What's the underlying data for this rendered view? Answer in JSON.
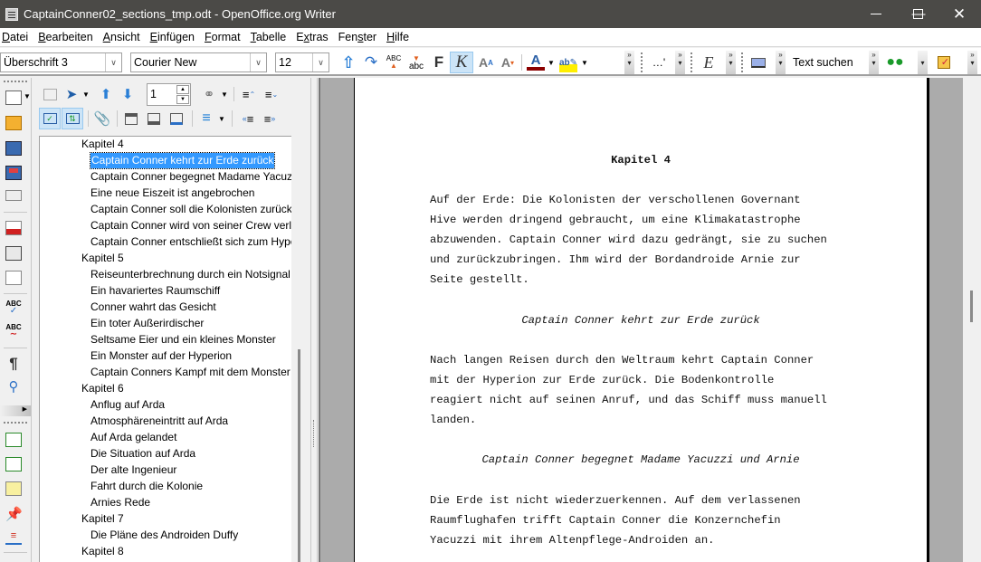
{
  "window": {
    "title": "CaptainConner02_sections_tmp.odt - OpenOffice.org Writer",
    "minimize_icon": "minimize-icon",
    "maximize_icon": "maximize-icon",
    "close_icon": "close-icon"
  },
  "menu": {
    "items": [
      {
        "label": "Datei",
        "accel": "D"
      },
      {
        "label": "Bearbeiten",
        "accel": "B"
      },
      {
        "label": "Ansicht",
        "accel": "A"
      },
      {
        "label": "Einfügen",
        "accel": "E"
      },
      {
        "label": "Format",
        "accel": "F"
      },
      {
        "label": "Tabelle",
        "accel": "T"
      },
      {
        "label": "Extras",
        "accel": "x"
      },
      {
        "label": "Fenster",
        "accel": "s"
      },
      {
        "label": "Hilfe",
        "accel": "H"
      }
    ]
  },
  "format_toolbar": {
    "paragraph_style": "Überschrift 3",
    "font_name": "Courier New",
    "font_size": "12",
    "bold_label": "F",
    "italic_label": "K",
    "find_placeholder": "Text suchen",
    "emphasis_label": "E",
    "ellipsis_label": "…'",
    "italic_active": true
  },
  "navigator": {
    "page_number": "1",
    "tree": [
      {
        "label": "Kapitel 4",
        "level": 0
      },
      {
        "label": "Captain Conner kehrt zur Erde zurück",
        "level": 1,
        "selected": true
      },
      {
        "label": "Captain Conner begegnet Madame Yacuzzi und Arnie",
        "level": 1
      },
      {
        "label": "Eine neue Eiszeit ist angebrochen",
        "level": 1
      },
      {
        "label": "Captain Conner soll die Kolonisten zurückholen",
        "level": 1
      },
      {
        "label": "Captain Conner wird von seiner Crew verlassen",
        "level": 1
      },
      {
        "label": "Captain Conner entschließt sich zum Hyperion",
        "level": 1
      },
      {
        "label": "Kapitel 5",
        "level": 0
      },
      {
        "label": "Reiseunterbrechnung durch ein Notsignal",
        "level": 1
      },
      {
        "label": "Ein havariertes Raumschiff",
        "level": 1
      },
      {
        "label": "Conner wahrt das Gesicht",
        "level": 1
      },
      {
        "label": "Ein toter Außerirdischer",
        "level": 1
      },
      {
        "label": "Seltsame Eier und ein kleines Monster",
        "level": 1
      },
      {
        "label": "Ein Monster auf der Hyperion",
        "level": 1
      },
      {
        "label": "Captain Conners Kampf mit dem Monster",
        "level": 1
      },
      {
        "label": "Kapitel 6",
        "level": 0
      },
      {
        "label": "Anflug auf Arda",
        "level": 1
      },
      {
        "label": "Atmosphäreneintritt auf Arda",
        "level": 1
      },
      {
        "label": "Auf Arda gelandet",
        "level": 1
      },
      {
        "label": "Die Situation auf Arda",
        "level": 1
      },
      {
        "label": "Der alte Ingenieur",
        "level": 1
      },
      {
        "label": "Fahrt durch die Kolonie",
        "level": 1
      },
      {
        "label": "Arnies Rede",
        "level": 1
      },
      {
        "label": "Kapitel 7",
        "level": 0
      },
      {
        "label": "Die Pläne des Androiden Duffy",
        "level": 1
      },
      {
        "label": "Kapitel 8",
        "level": 0
      }
    ]
  },
  "document": {
    "heading": "Kapitel 4",
    "blocks": [
      {
        "type": "para",
        "lines": [
          "Auf der Erde: Die Kolonisten der verschollenen Governant",
          "Hive werden dringend gebraucht, um eine Klimakatastrophe",
          "abzuwenden. Captain Conner wird dazu gedrängt, sie zu suchen",
          "und zurückzubringen. Ihm wird der Bordandroide Arnie zur",
          "Seite gestellt."
        ]
      },
      {
        "type": "subheading",
        "text": "Captain Conner kehrt zur Erde zurück"
      },
      {
        "type": "para",
        "lines": [
          "Nach langen Reisen durch den Weltraum kehrt Captain Conner",
          "mit der Hyperion zur Erde zurück. Die Bodenkontrolle",
          "reagiert nicht auf seinen Anruf, und das Schiff muss manuell",
          "landen."
        ]
      },
      {
        "type": "subheading",
        "text": "Captain Conner begegnet Madame Yacuzzi und Arnie"
      },
      {
        "type": "para",
        "lines": [
          "Die Erde ist nicht wiederzuerkennen. Auf dem verlassenen",
          "Raumflughafen trifft Captain Conner die Konzernchefin",
          "Yacuzzi mit ihrem Altenpflege-Androiden an."
        ]
      }
    ]
  }
}
